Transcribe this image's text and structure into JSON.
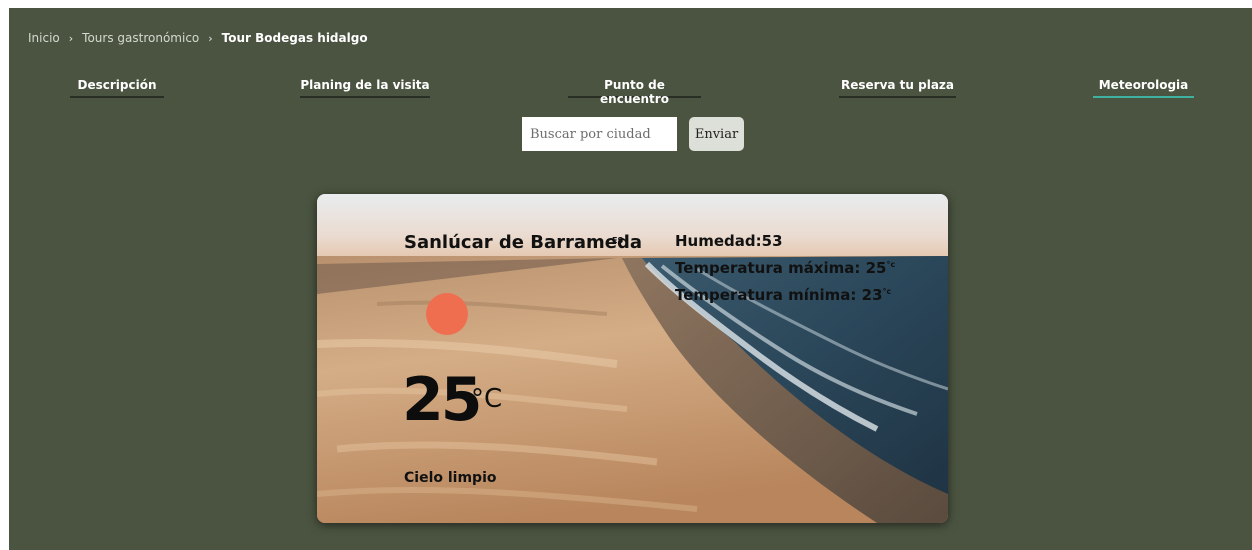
{
  "breadcrumb": {
    "items": [
      "Inicio",
      "Tours gastronómico",
      "Tour Bodegas hidalgo"
    ],
    "separator": "›"
  },
  "tabs": [
    {
      "label": "Descripción"
    },
    {
      "label": "Planing de la visita"
    },
    {
      "label": "Punto de encuentro"
    },
    {
      "label": "Reserva tu plaza"
    },
    {
      "label": "Meteorologia",
      "active": true
    }
  ],
  "search": {
    "placeholder": "Buscar por ciudad",
    "value": "",
    "button_label": "Enviar"
  },
  "weather": {
    "city": "Sanlúcar de Barrameda",
    "country": "ES",
    "humidity_label": "Humedad:",
    "humidity": "53",
    "max_label": "Temperatura máxima: ",
    "max": "25",
    "min_label": "Temperatura mínima: ",
    "min": "23",
    "small_unit": "°c",
    "temp": "25",
    "temp_unit": "°C",
    "description": "Cielo limpio",
    "icon": "sun-icon"
  },
  "colors": {
    "page_bg": "#4b5441",
    "tab_underline": "#2a2f25",
    "tab_active_underline": "#3fb1a2",
    "sun": "#ef6e50",
    "button_bg": "#dde0d8"
  }
}
